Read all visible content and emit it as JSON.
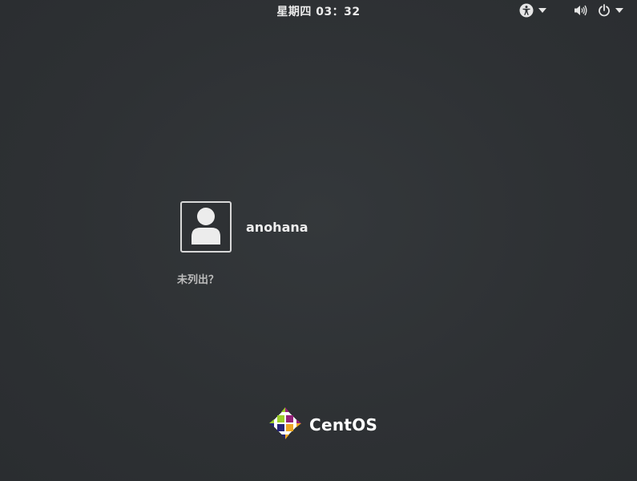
{
  "topbar": {
    "clock": "星期四 03：32",
    "icons": {
      "accessibility": "accessibility-icon",
      "volume": "volume-icon",
      "power": "power-icon",
      "dropdown": "chevron-down-icon"
    }
  },
  "login": {
    "username": "anohana",
    "not_listed": "未列出？",
    "avatar_icon": "user-avatar-icon"
  },
  "branding": {
    "name": "CentOS",
    "logo_colors": [
      "#9ccd2a",
      "#932279",
      "#efa724",
      "#262577"
    ]
  }
}
